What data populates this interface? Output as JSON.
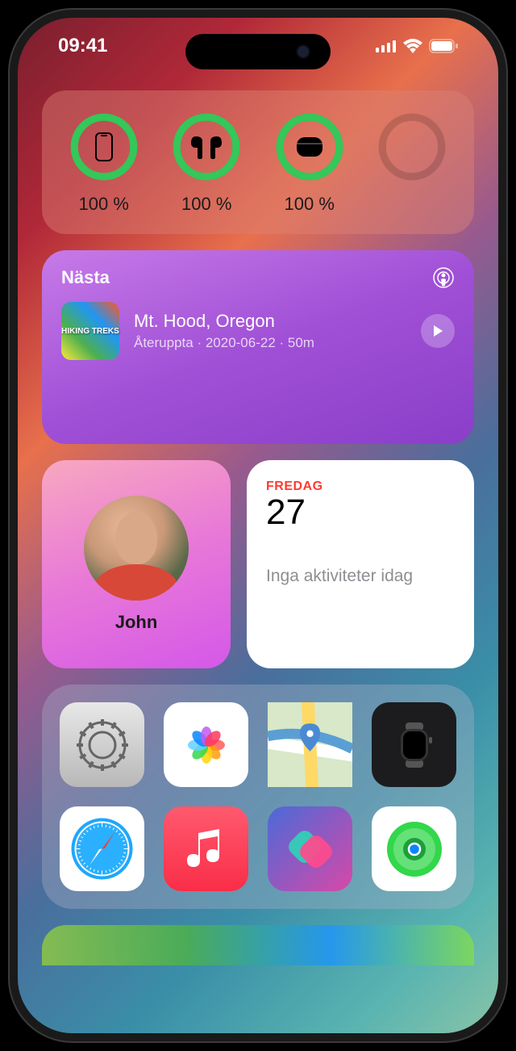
{
  "status": {
    "time": "09:41"
  },
  "batteries": {
    "items": [
      {
        "icon": "phone",
        "label": "100 %"
      },
      {
        "icon": "airpods",
        "label": "100 %"
      },
      {
        "icon": "case",
        "label": "100 %"
      },
      {
        "icon": "empty",
        "label": ""
      }
    ]
  },
  "podcast": {
    "header": "Nästa",
    "artwork_text": "HIKING TREKS",
    "episode_title": "Mt. Hood, Oregon",
    "meta": "Återuppta · 2020-06-22 · 50m"
  },
  "contact": {
    "name": "John"
  },
  "calendar": {
    "day_name": "FREDAG",
    "date_num": "27",
    "events_text": "Inga aktiviteter idag"
  },
  "apps": [
    {
      "name": "settings",
      "class": "ic-settings"
    },
    {
      "name": "photos",
      "class": "ic-photos"
    },
    {
      "name": "maps",
      "class": "ic-maps"
    },
    {
      "name": "watch",
      "class": "ic-watch"
    },
    {
      "name": "safari",
      "class": "ic-safari"
    },
    {
      "name": "music",
      "class": "ic-music"
    },
    {
      "name": "shortcuts",
      "class": "ic-shortcuts"
    },
    {
      "name": "findmy",
      "class": "ic-findmy"
    }
  ]
}
